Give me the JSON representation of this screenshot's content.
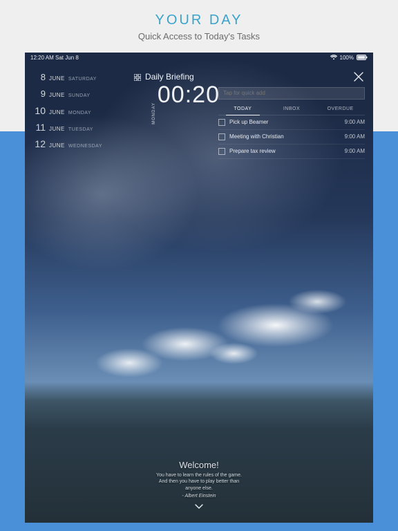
{
  "promo": {
    "title": "YOUR DAY",
    "subtitle": "Quick Access to Today's Tasks"
  },
  "status": {
    "time_date": "12:20 AM  Sat Jun 8",
    "battery_pct": "100%"
  },
  "dates": [
    {
      "day": "8",
      "month": "JUNE",
      "weekday": "SATURDAY"
    },
    {
      "day": "9",
      "month": "JUNE",
      "weekday": "SUNDAY"
    },
    {
      "day": "10",
      "month": "JUNE",
      "weekday": "MONDAY"
    },
    {
      "day": "11",
      "month": "JUNE",
      "weekday": "TUESDAY"
    },
    {
      "day": "12",
      "month": "JUNE",
      "weekday": "WEDNESDAY"
    }
  ],
  "briefing": {
    "title": "Daily Briefing",
    "clock_day": "MONDAY",
    "clock_time": "00:20",
    "quickadd_placeholder": "Tap for quick add"
  },
  "tabs": {
    "today": "TODAY",
    "inbox": "INBOX",
    "overdue": "OVERDUE"
  },
  "tasks": [
    {
      "title": "Pick up Beamer",
      "time": "9:00 AM"
    },
    {
      "title": "Meeting with Christian",
      "time": "9:00 AM"
    },
    {
      "title": "Prepare tax review",
      "time": "9:00 AM"
    }
  ],
  "welcome": {
    "heading": "Welcome!",
    "line1": "You have to learn the rules of the game.",
    "line2": "And then you have to play better than",
    "line3": "anyone else.",
    "byline": "- Albert Einstein"
  },
  "icons": {
    "grid": "grid-icon",
    "close": "close-icon",
    "wifi": "wifi-icon",
    "battery": "battery-icon",
    "chevron": "chevron-down-icon"
  }
}
